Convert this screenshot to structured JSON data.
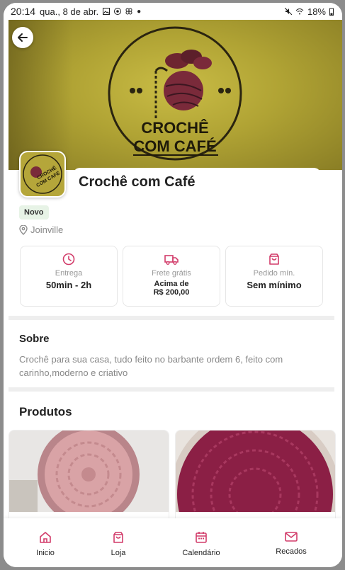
{
  "status_bar": {
    "time": "20:14",
    "date": "qua., 8 de abr.",
    "battery": "18%"
  },
  "store": {
    "name": "Crochê com Café",
    "badge": "Novo",
    "location": "Joinville",
    "logo_text_line1": "CROCHÊ",
    "logo_text_line2": "COM CAFÉ"
  },
  "info": [
    {
      "icon": "clock-icon",
      "label": "Entrega",
      "value": "50min - 2h"
    },
    {
      "icon": "truck-icon",
      "label": "Frete grátis",
      "value_line1": "Acima de",
      "value_line2": "R$ 200,00"
    },
    {
      "icon": "shopping-bag-icon",
      "label": "Pedido mín.",
      "value": "Sem mínimo"
    }
  ],
  "about": {
    "title": "Sobre",
    "text": "Crochê para sua casa, tudo feito no barbante ordem 6, feito com carinho,moderno e criativo"
  },
  "products": {
    "title": "Produtos"
  },
  "nav": [
    {
      "label": "Inicio",
      "icon": "home-icon"
    },
    {
      "label": "Loja",
      "icon": "shopping-bag-icon"
    },
    {
      "label": "Calendário",
      "icon": "calendar-icon"
    },
    {
      "label": "Recados",
      "icon": "mail-icon"
    }
  ],
  "colors": {
    "accent": "#d23c6a",
    "product_pink": "#d9a3a6",
    "product_wine": "#8b1f45"
  }
}
